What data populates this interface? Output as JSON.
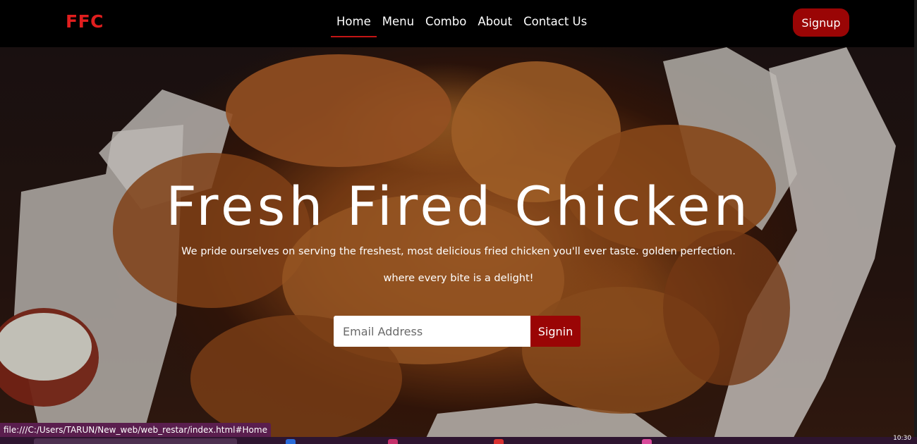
{
  "navbar": {
    "logo": "FFC",
    "links": [
      {
        "label": "Home",
        "active": true
      },
      {
        "label": "Menu",
        "active": false
      },
      {
        "label": "Combo",
        "active": false
      },
      {
        "label": "About",
        "active": false
      },
      {
        "label": "Contact Us",
        "active": false
      }
    ],
    "signup_label": "Signup"
  },
  "hero": {
    "title": "Fresh Fired Chicken",
    "subtitle_line1": "We pride ourselves on serving the freshest, most delicious fried chicken you'll ever taste. golden perfection.",
    "subtitle_line2": "where every bite is a delight!",
    "email_placeholder": "Email Address",
    "signin_label": "Signin"
  },
  "status_bar": {
    "url": "file:///C:/Users/TARUN/New_web/web_restar/index.html#Home"
  },
  "taskbar": {
    "clock": "10:30"
  },
  "colors": {
    "brand_red": "#e01e1e",
    "button_red": "#9a0505",
    "navbar_bg": "#000000"
  }
}
